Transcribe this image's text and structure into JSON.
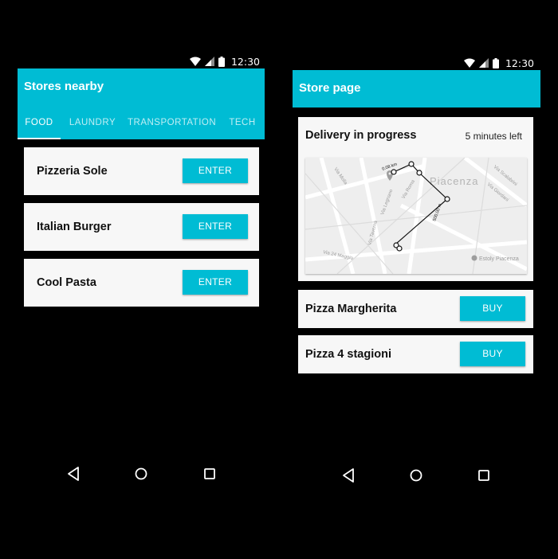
{
  "status_bar": {
    "time": "12:30"
  },
  "left_screen": {
    "app_bar": {
      "title": "Stores nearby"
    },
    "tabs": [
      "FOOD",
      "LAUNDRY",
      "TRANSPORTATION",
      "TECH"
    ],
    "active_tab": "FOOD",
    "stores": [
      {
        "name": "Pizzeria Sole",
        "button": "ENTER"
      },
      {
        "name": "Italian Burger",
        "button": "ENTER"
      },
      {
        "name": "Cool Pasta",
        "button": "ENTER"
      }
    ]
  },
  "right_screen": {
    "app_bar": {
      "title": "Store page"
    },
    "delivery": {
      "title": "Delivery in progress",
      "time_left": "5 minutes left",
      "map": {
        "city_label": "Piacenza",
        "streets": [
          "Via Molla",
          "Via Taverna",
          "Via Legnano",
          "Via 24 Maggio",
          "Via Scalabrini",
          "Via Giordani",
          "Via Roma"
        ],
        "distances": [
          "0.08 km",
          "500.00 m"
        ],
        "place": "Estoly Piacenza"
      }
    },
    "items": [
      {
        "name": "Pizza Margherita",
        "button": "BUY"
      },
      {
        "name": "Pizza 4 stagioni",
        "button": "BUY"
      }
    ]
  },
  "colors": {
    "accent": "#00BCD4",
    "background": "#000000",
    "card": "#F7F7F7"
  },
  "icons": [
    "wifi-icon",
    "signal-icon",
    "battery-icon",
    "back-icon",
    "home-icon",
    "recents-icon",
    "map-pin-icon"
  ]
}
